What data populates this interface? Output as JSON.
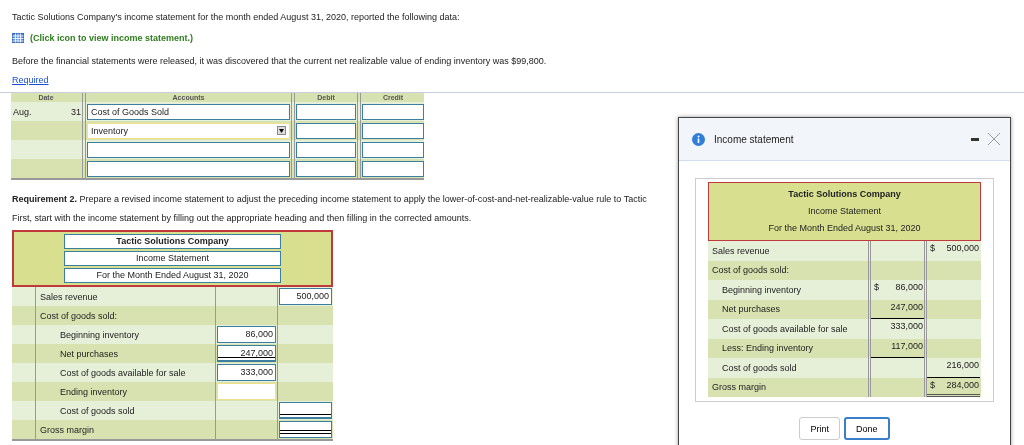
{
  "intro": "Tactic Solutions Company's income statement for the month ended August 31, 2020, reported the following data:",
  "statement_link": "(Click icon to view income statement.)",
  "note": "Before the financial statements were released, it was discovered that the current net realizable value of ending inventory was $99,800.",
  "required_link": "Required",
  "journal": {
    "columns": [
      "Date",
      "Accounts",
      "Debit",
      "Credit"
    ],
    "rows": [
      {
        "month": "Aug.",
        "day": "31",
        "account": {
          "kind": "input",
          "value": "Cost of Goods Sold"
        }
      },
      {
        "account": {
          "kind": "select",
          "value": "Inventory"
        }
      },
      {
        "account": {
          "kind": "input"
        }
      },
      {
        "account": {
          "kind": "input"
        }
      }
    ]
  },
  "requirement": {
    "label": "Requirement 2.",
    "text": "Prepare a revised income statement to adjust the preceding income statement to apply the lower-of-cost-and-net-realizable-value rule to Tactic"
  },
  "instruction": "First, start with the income statement by filling out the appropriate heading and then filling in the corrected amounts.",
  "worksheet": {
    "heading": [
      "Tactic Solutions Company",
      "Income Statement",
      "For the Month Ended August 31, 2020"
    ],
    "rows": [
      {
        "label": "Sales revenue",
        "total": {
          "value": "500,000"
        }
      },
      {
        "label": "Cost of goods sold:",
        "children": [
          {
            "label": "Beginning inventory",
            "amount": {
              "value": "86,000"
            }
          },
          {
            "label": "Net purchases",
            "amount": {
              "value": "247,000",
              "underlined": true
            }
          },
          {
            "label": "Cost of goods available for sale",
            "amount": {
              "value": "333,000"
            }
          },
          {
            "label": "Ending inventory",
            "amount": {
              "highlighted": true
            }
          },
          {
            "label": "Cost of goods sold",
            "total": {
              "underlined": true
            }
          }
        ]
      },
      {
        "label": "Gross margin",
        "total": {
          "double_underlined": true
        }
      }
    ]
  },
  "dialog": {
    "title": "Income statement",
    "heading": [
      "Tactic Solutions Company",
      "Income Statement",
      "For the Month Ended August 31, 2020"
    ],
    "rows": [
      {
        "label": "Sales revenue",
        "total": {
          "currency": "$",
          "value": "500,000"
        }
      },
      {
        "label": "Cost of goods sold:",
        "children": [
          {
            "label": "Beginning inventory",
            "amount": {
              "currency": "$",
              "value": "86,000"
            }
          },
          {
            "label": "Net purchases",
            "amount": {
              "value": "247,000",
              "underlined": true
            }
          },
          {
            "label": "Cost of goods available for sale",
            "amount": {
              "value": "333,000"
            }
          },
          {
            "label": "Less: Ending inventory",
            "amount": {
              "value": "117,000",
              "underlined": true
            }
          },
          {
            "label": "Cost of goods sold",
            "total": {
              "value": "216,000",
              "underlined": true
            }
          }
        ]
      },
      {
        "label": "Gross margin",
        "total": {
          "currency": "$",
          "value": "284,000",
          "double_underlined": true
        }
      }
    ]
  },
  "buttons": [
    {
      "label": "Print",
      "selected": false
    },
    {
      "label": "Done",
      "selected": true
    }
  ]
}
